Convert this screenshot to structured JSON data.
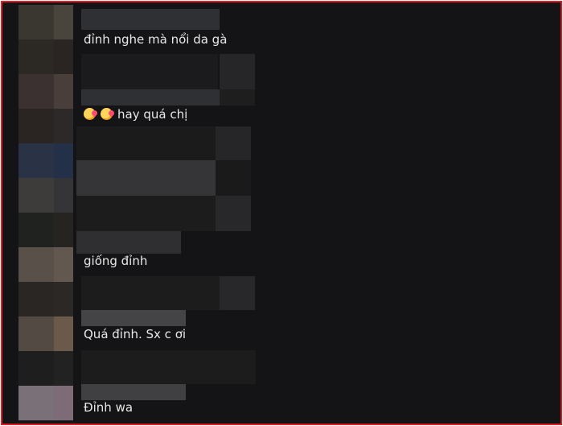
{
  "comments": [
    {
      "text": "đỉnh nghe mà nổi da gà"
    },
    {
      "emojis": [
        "smiling-face-with-hearts-icon",
        "smiling-face-with-hearts-icon"
      ],
      "text": "hay quá chị"
    },
    {
      "text": "giống đỉnh"
    },
    {
      "text": "Quá đỉnh. Sx c ơi"
    },
    {
      "text": "Đỉnh wa"
    }
  ],
  "colors": {
    "border": "#e41e26",
    "background": "#141416",
    "text": "#e8e8e8"
  }
}
